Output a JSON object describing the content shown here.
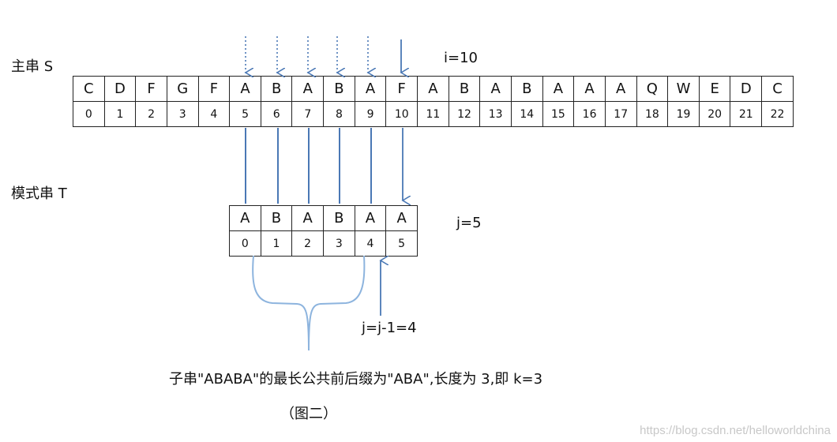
{
  "main_string": {
    "label": "主串 S",
    "chars": [
      "C",
      "D",
      "F",
      "G",
      "F",
      "A",
      "B",
      "A",
      "B",
      "A",
      "F",
      "A",
      "B",
      "A",
      "B",
      "A",
      "A",
      "A",
      "Q",
      "W",
      "E",
      "D",
      "C"
    ],
    "indices": [
      "0",
      "1",
      "2",
      "3",
      "4",
      "5",
      "6",
      "7",
      "8",
      "9",
      "10",
      "11",
      "12",
      "13",
      "14",
      "15",
      "16",
      "17",
      "18",
      "19",
      "20",
      "21",
      "22"
    ],
    "i_label": "i=10"
  },
  "pattern": {
    "label": "模式串 T",
    "chars": [
      "A",
      "B",
      "A",
      "B",
      "A",
      "A"
    ],
    "indices": [
      "0",
      "1",
      "2",
      "3",
      "4",
      "5"
    ],
    "j_label": "j=5",
    "j_new_label": "j=j-1=4"
  },
  "caption": "子串\"ABABA\"的最长公共前后缀为\"ABA\",长度为 3,即 k=3",
  "figure_label": "（图二）",
  "watermark": "https://blog.csdn.net/helloworldchina",
  "colors": {
    "arrow": "#4a78b5",
    "border": "#222222"
  }
}
